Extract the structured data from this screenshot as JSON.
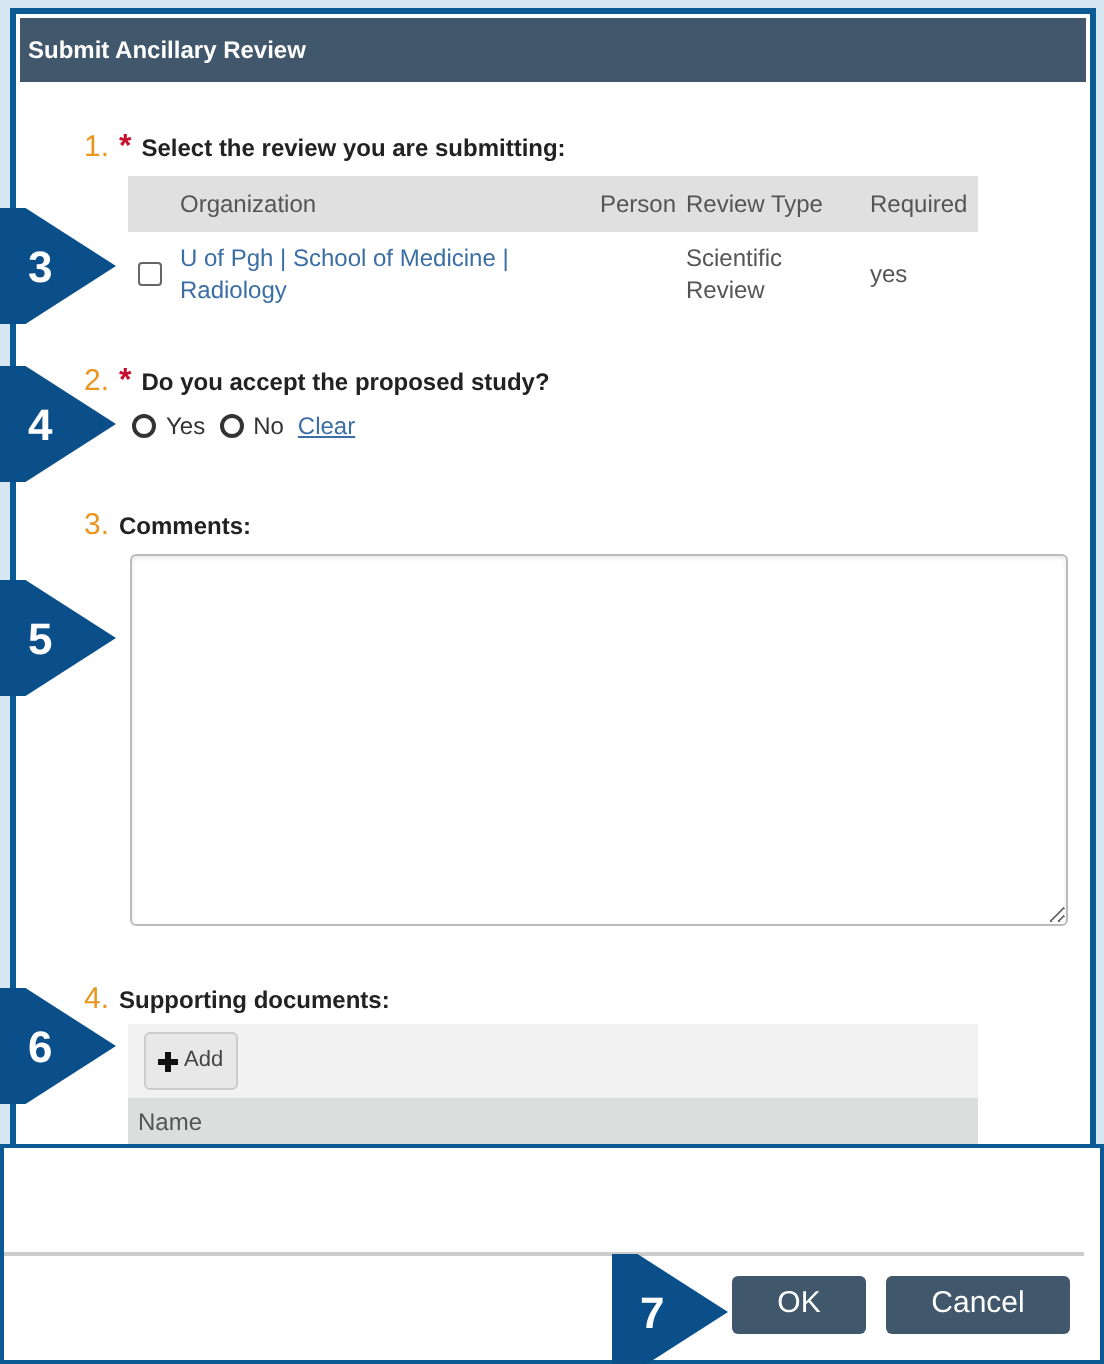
{
  "dialog": {
    "title": "Submit Ancillary Review"
  },
  "questions": [
    {
      "kind": "review-table",
      "number": "1.",
      "required_mark": "*",
      "label": "Select the review you are submitting:",
      "columns": [
        "Organization",
        "Person",
        "Review Type",
        "Required"
      ],
      "rows": [
        {
          "checked": false,
          "organization": "U of Pgh | School of Medicine | Radiology",
          "review_type": "Scientific Review",
          "required": "yes"
        }
      ]
    },
    {
      "kind": "radio",
      "number": "2.",
      "required_mark": "*",
      "label": "Do you accept the proposed study?",
      "options": [
        {
          "label": "Yes",
          "selected": false
        },
        {
          "label": "No",
          "selected": false
        }
      ],
      "clear": "Clear"
    },
    {
      "kind": "textarea",
      "number": "3.",
      "label": "Comments:"
    },
    {
      "kind": "documents",
      "number": "4.",
      "label": "Supporting documents:",
      "add_button": "Add",
      "columns": [
        "Name"
      ]
    }
  ],
  "buttons": [
    "OK",
    "Cancel"
  ],
  "callouts": [
    "3",
    "4",
    "5",
    "6",
    "7"
  ]
}
